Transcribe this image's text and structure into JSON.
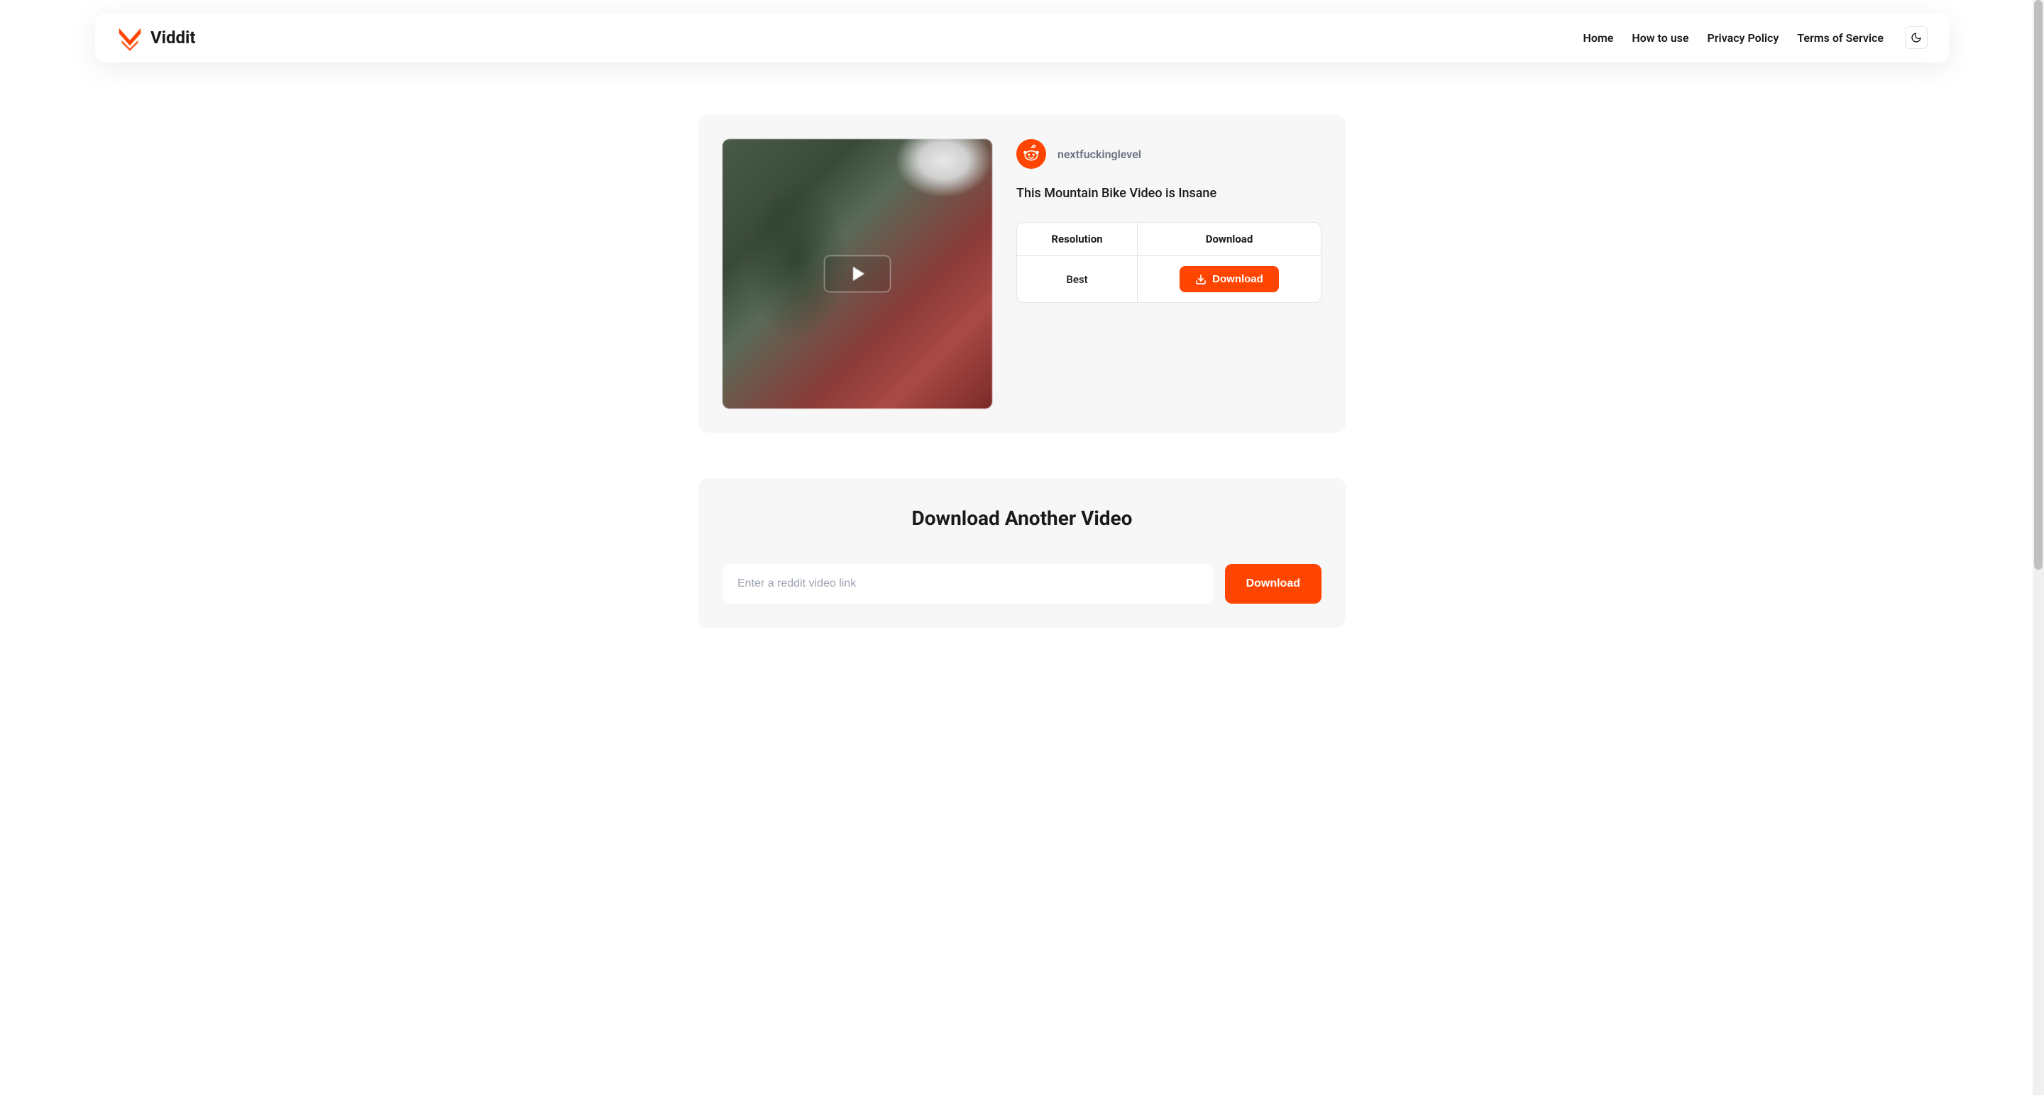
{
  "header": {
    "brand": "Viddit",
    "nav": [
      "Home",
      "How to use",
      "Privacy Policy",
      "Terms of Service"
    ]
  },
  "video": {
    "subreddit": "nextfuckinglevel",
    "title": "This Mountain Bike Video is Insane"
  },
  "table": {
    "headers": {
      "resolution": "Resolution",
      "download": "Download"
    },
    "rows": [
      {
        "resolution": "Best",
        "button_label": "Download"
      }
    ]
  },
  "section2": {
    "title": "Download Another Video",
    "placeholder": "Enter a reddit video link",
    "button": "Download"
  },
  "colors": {
    "accent": "#FF4500"
  }
}
